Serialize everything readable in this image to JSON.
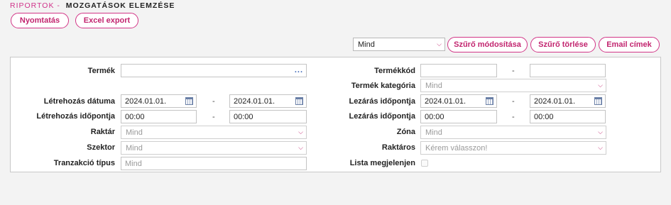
{
  "header": {
    "breadcrumb_prefix": "RIPORTOK -",
    "title": "MOZGATÁSOK ELEMZÉSE"
  },
  "toolbar": {
    "print_label": "Nyomtatás",
    "excel_label": "Excel export"
  },
  "filter_bar": {
    "preset_value": "Mind",
    "modify_label": "Szűrő módosítása",
    "clear_label": "Szűrő törlése",
    "email_label": "Email címek"
  },
  "form": {
    "left": {
      "product_label": "Termék",
      "product_value": "",
      "created_date_label": "Létrehozás dátuma",
      "created_date_from": "2024.01.01.",
      "created_date_to": "2024.01.01.",
      "created_time_label": "Létrehozás időpontja",
      "created_time_from": "00:00",
      "created_time_to": "00:00",
      "warehouse_label": "Raktár",
      "warehouse_value": "Mind",
      "sector_label": "Szektor",
      "sector_value": "Mind",
      "transaction_type_label": "Tranzakció típus",
      "transaction_type_value": "Mind"
    },
    "right": {
      "product_code_label": "Termékkód",
      "product_code_from": "",
      "product_code_to": "",
      "product_category_label": "Termék kategória",
      "product_category_value": "Mind",
      "closing_date_label": "Lezárás időpontja",
      "closing_date_from": "2024.01.01.",
      "closing_date_to": "2024.01.01.",
      "closing_time_label": "Lezárás időpontja",
      "closing_time_from": "00:00",
      "closing_time_to": "00:00",
      "zone_label": "Zóna",
      "zone_value": "Mind",
      "storekeeper_label": "Raktáros",
      "storekeeper_placeholder": "Kérem válasszon!",
      "show_list_label": "Lista megjelenjen"
    },
    "range_separator": "-"
  },
  "icons": {
    "calendar": "calendar-icon",
    "dropdown": "chevron-down-icon",
    "more": "ellipsis-icon"
  },
  "colors": {
    "accent": "#d0338a",
    "background": "#f3f3f3",
    "panel": "#ffffff"
  }
}
